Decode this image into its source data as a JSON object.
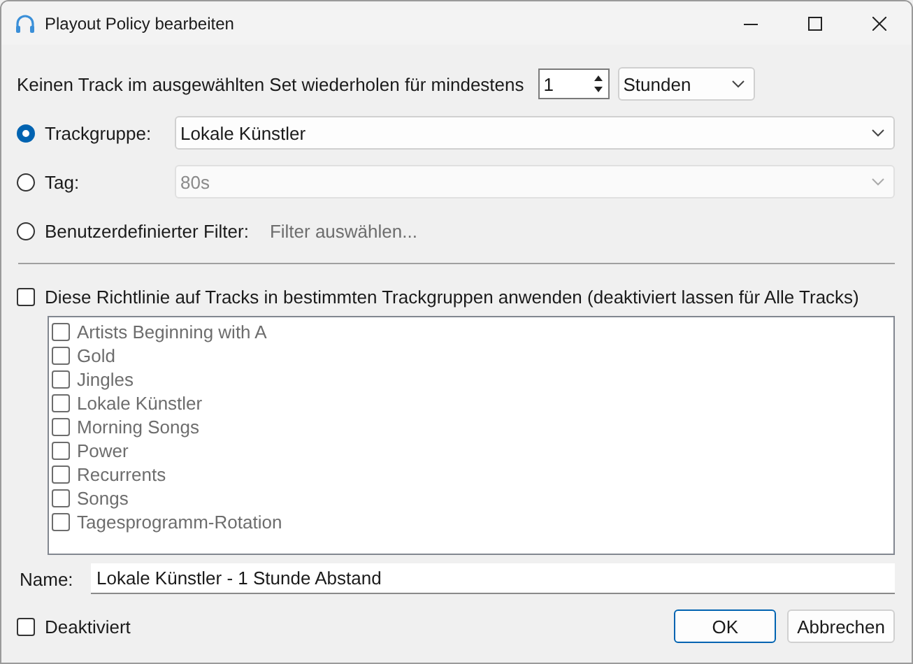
{
  "window": {
    "title": "Playout Policy bearbeiten"
  },
  "repeat": {
    "label": "Keinen Track im ausgewählten Set wiederholen für mindestens",
    "value": "1",
    "unit": "Stunden"
  },
  "sources": [
    {
      "kind": "dropdown",
      "label": "Trackgruppe:",
      "selected": true,
      "value": "Lokale Künstler",
      "disabled": false
    },
    {
      "kind": "dropdown",
      "label": "Tag:",
      "selected": false,
      "value": "80s",
      "disabled": true
    },
    {
      "kind": "link",
      "label": "Benutzerdefinierter Filter:",
      "selected": false,
      "value": "Filter auswählen...",
      "disabled": true
    }
  ],
  "apply_groups": {
    "label": "Diese Richtlinie auf Tracks in bestimmten Trackgruppen anwenden (deaktiviert lassen für Alle Tracks)",
    "checked": false
  },
  "groups": {
    "disabled": true,
    "items": [
      {
        "label": "Artists Beginning with A",
        "checked": false
      },
      {
        "label": "Gold",
        "checked": false
      },
      {
        "label": "Jingles",
        "checked": false
      },
      {
        "label": "Lokale Künstler",
        "checked": false
      },
      {
        "label": "Morning Songs",
        "checked": false
      },
      {
        "label": "Power",
        "checked": false
      },
      {
        "label": "Recurrents",
        "checked": false
      },
      {
        "label": "Songs",
        "checked": false
      },
      {
        "label": "Tagesprogramm-Rotation",
        "checked": false
      }
    ]
  },
  "name": {
    "label": "Name:",
    "value": "Lokale Künstler - 1 Stunde Abstand"
  },
  "deactivated": {
    "label": "Deaktiviert",
    "checked": false
  },
  "buttons": [
    {
      "label": "OK",
      "default": true
    },
    {
      "label": "Abbrechen",
      "default": false
    }
  ]
}
